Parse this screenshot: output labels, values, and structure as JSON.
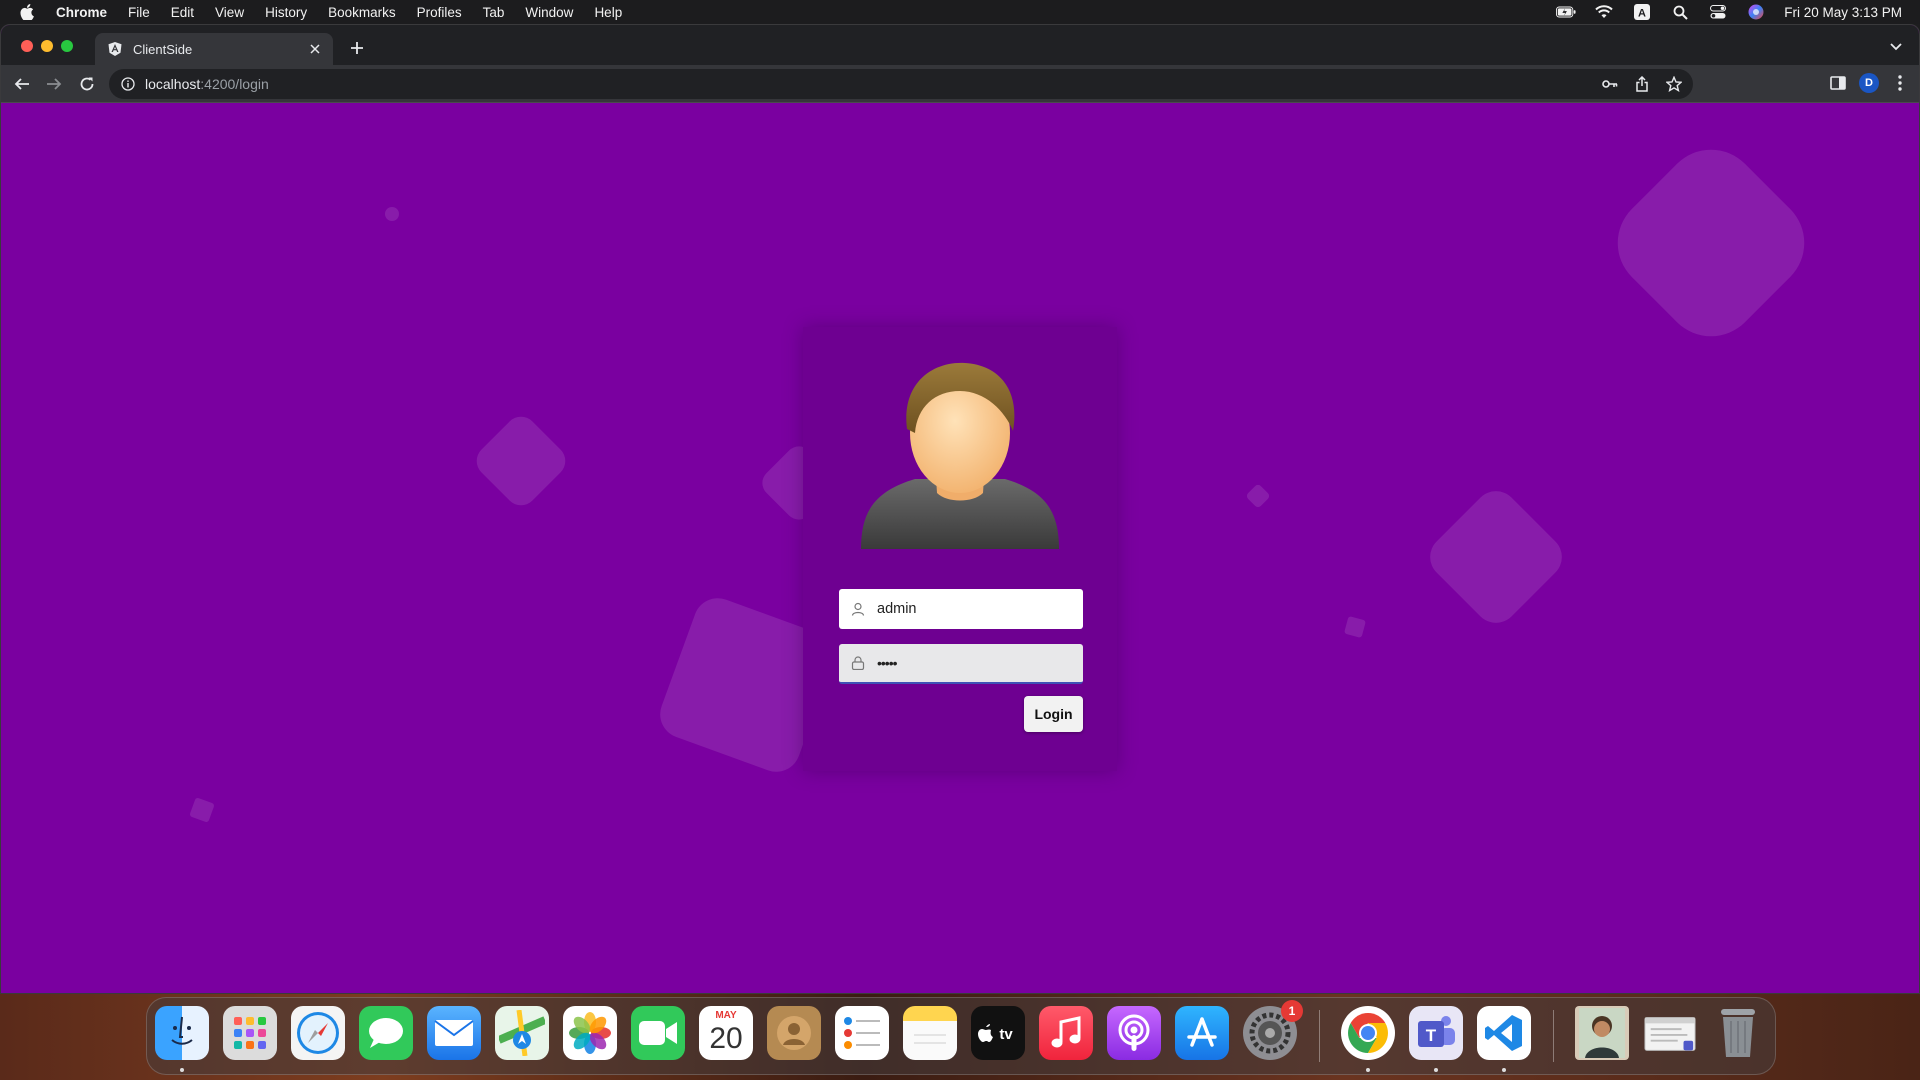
{
  "menubar": {
    "app_name": "Chrome",
    "items": [
      "File",
      "Edit",
      "View",
      "History",
      "Bookmarks",
      "Profiles",
      "Tab",
      "Window",
      "Help"
    ],
    "clock": "Fri 20 May  3:13 PM",
    "status_icons": [
      "battery-icon",
      "wifi-icon",
      "keyboard-input-icon",
      "spotlight-search-icon",
      "control-center-icon",
      "siri-icon"
    ]
  },
  "browser": {
    "tab_title": "ClientSide",
    "url_host": "localhost",
    "url_path": ":4200/login",
    "profile_initial": "D"
  },
  "login": {
    "username_value": "admin",
    "password_value": "•••••",
    "login_label": "Login"
  },
  "dock": {
    "calendar_month": "MAY",
    "calendar_day": "20",
    "settings_badge": "1",
    "apps": [
      "Finder",
      "Launchpad",
      "Safari",
      "Messages",
      "Mail",
      "Maps",
      "Photos",
      "FaceTime",
      "Calendar",
      "Contacts",
      "Reminders",
      "Notes",
      "TV",
      "Music",
      "Podcasts",
      "App Store",
      "System Preferences",
      "Google Chrome",
      "Microsoft Teams",
      "Visual Studio Code"
    ]
  },
  "colors": {
    "page_background": "#7a00a0",
    "card_background": "#6e0091",
    "input_focus_underline": "#3f51b5"
  }
}
